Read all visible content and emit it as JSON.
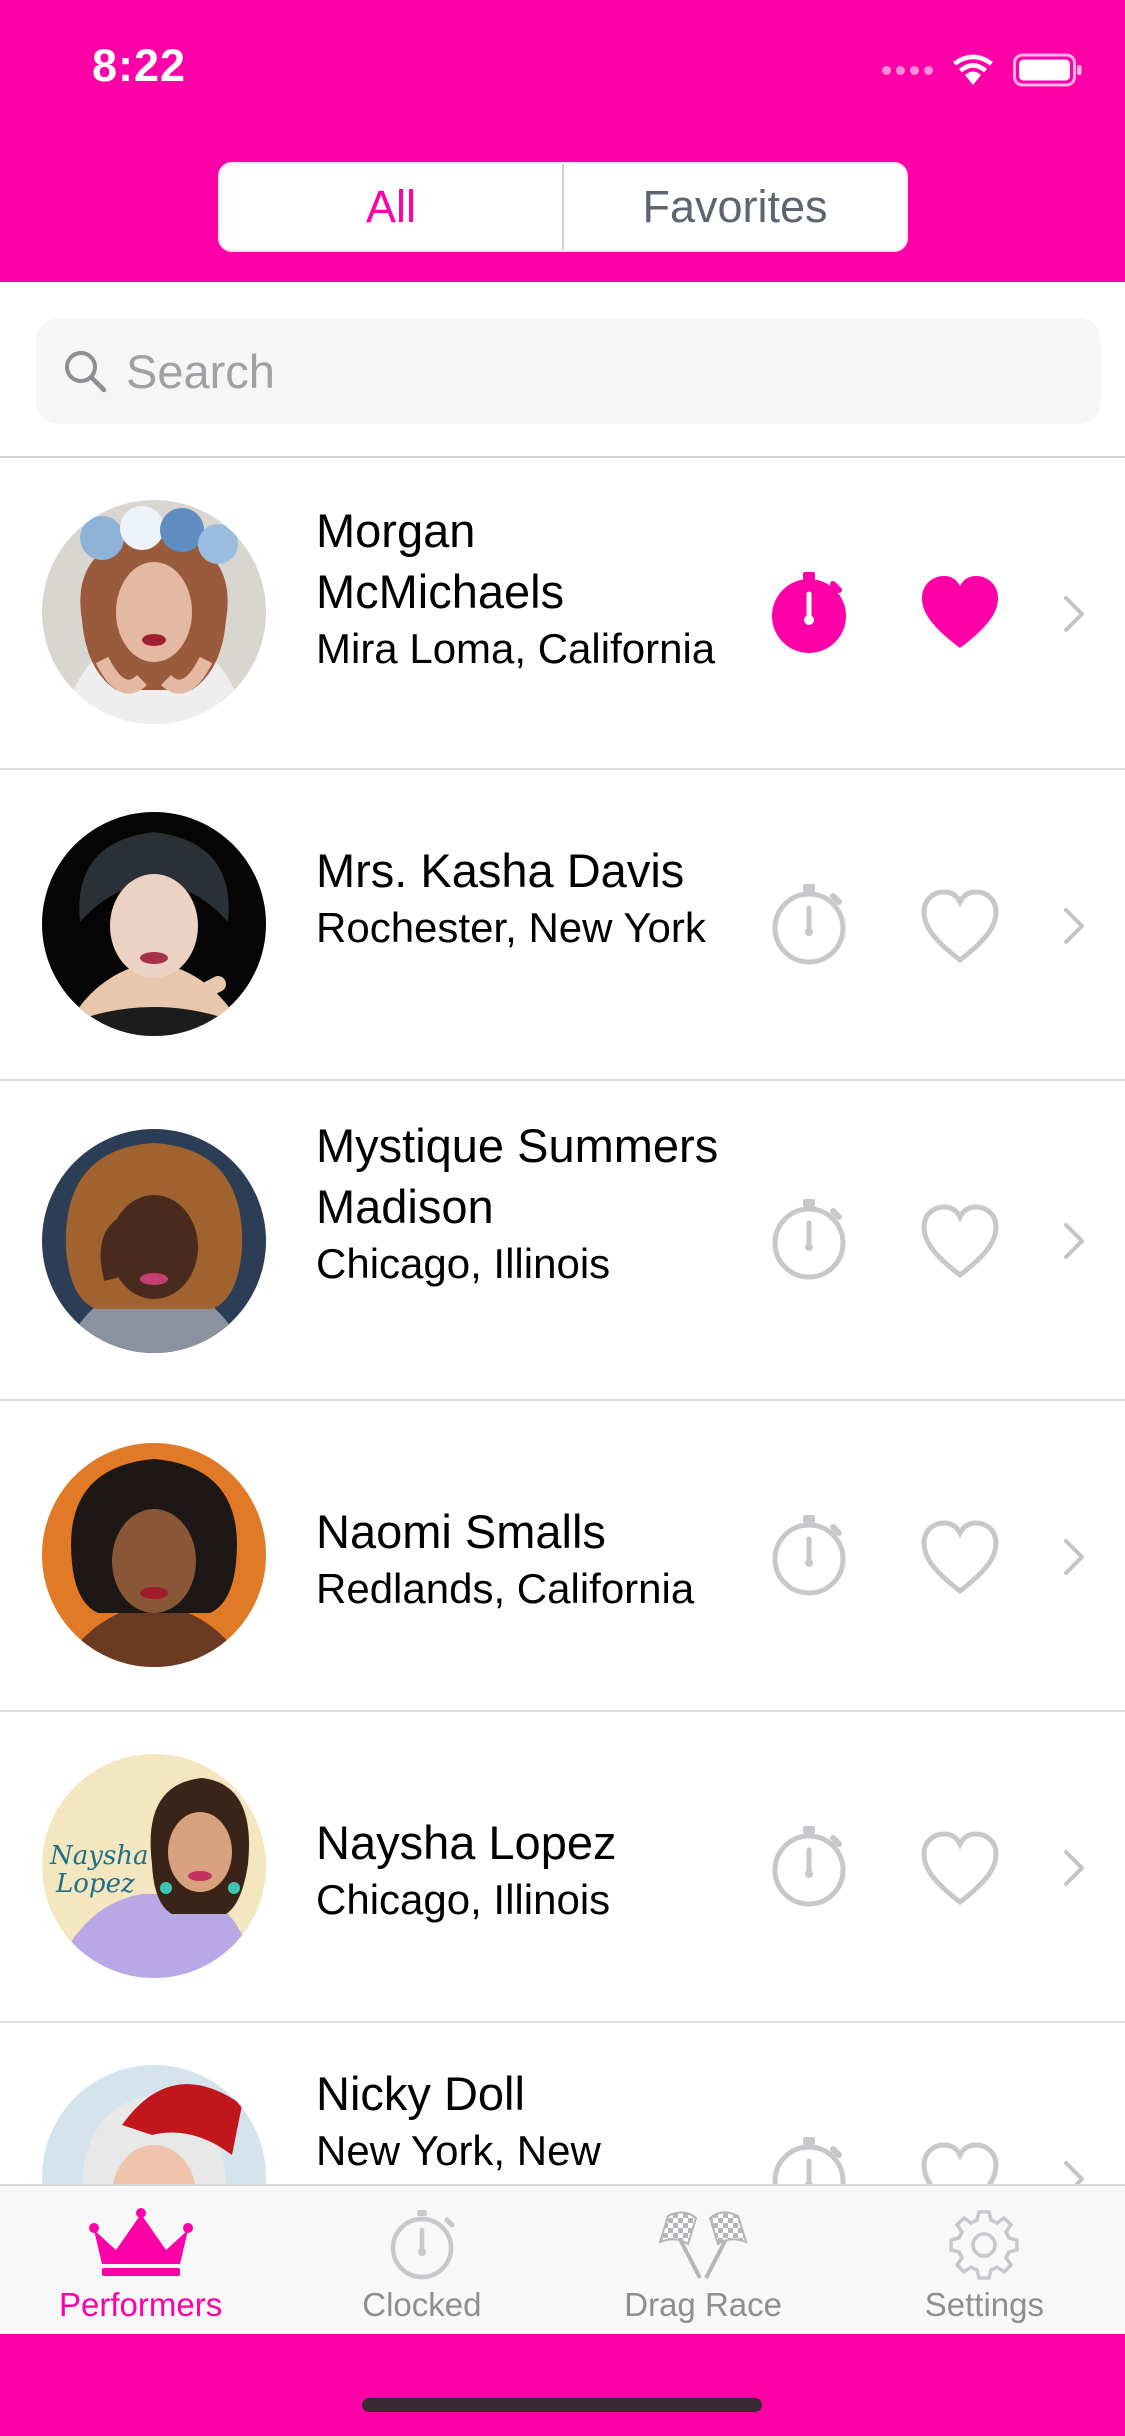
{
  "status_bar": {
    "time": "8:22"
  },
  "segments": [
    {
      "label": "All",
      "active": true
    },
    {
      "label": "Favorites",
      "active": false
    }
  ],
  "search": {
    "placeholder": "Search",
    "value": ""
  },
  "performers": [
    {
      "name": "Morgan McMichaels",
      "location": "Mira Loma, California",
      "clocked": true,
      "favorite": true
    },
    {
      "name": "Mrs. Kasha Davis",
      "location": "Rochester, New York",
      "clocked": false,
      "favorite": false
    },
    {
      "name": "Mystique Summers Madison",
      "location": "Chicago, Illinois",
      "clocked": false,
      "favorite": false
    },
    {
      "name": "Naomi Smalls",
      "location": "Redlands, California",
      "clocked": false,
      "favorite": false
    },
    {
      "name": "Naysha Lopez",
      "location": "Chicago, Illinois",
      "clocked": false,
      "favorite": false
    },
    {
      "name": "Nicky Doll",
      "location": "New York, New",
      "clocked": false,
      "favorite": false
    }
  ],
  "tabs": [
    {
      "label": "Performers",
      "icon": "crown-icon",
      "active": true
    },
    {
      "label": "Clocked",
      "icon": "stopwatch-icon",
      "active": false
    },
    {
      "label": "Drag Race",
      "icon": "checkered-flags-icon",
      "active": false
    },
    {
      "label": "Settings",
      "icon": "gear-icon",
      "active": false
    }
  ],
  "colors": {
    "accent": "#ff00a8",
    "inactive_icon": "#c7c7cc",
    "tab_inactive": "#8e8e93"
  }
}
